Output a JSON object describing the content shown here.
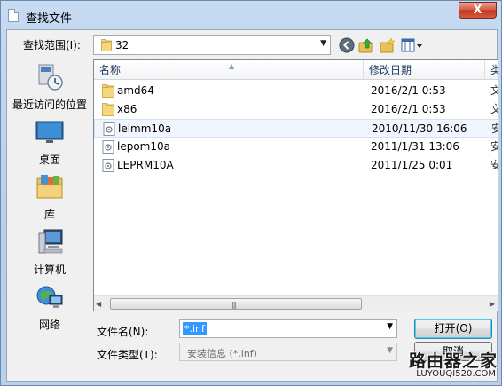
{
  "window": {
    "title": "查找文件",
    "close_glyph": "X"
  },
  "lookin": {
    "label": "查找范围(I):",
    "value": "32"
  },
  "toolbar": {
    "icons": [
      "back-icon",
      "up-folder-icon",
      "new-folder-icon",
      "views-menu-icon"
    ]
  },
  "places": [
    {
      "label": "最近访问的位置",
      "icon": "recent-places-icon"
    },
    {
      "label": "桌面",
      "icon": "desktop-icon"
    },
    {
      "label": "库",
      "icon": "libraries-icon"
    },
    {
      "label": "计算机",
      "icon": "computer-icon"
    },
    {
      "label": "网络",
      "icon": "network-icon"
    }
  ],
  "filelist": {
    "columns": {
      "name": "名称",
      "date": "修改日期",
      "more": "类"
    },
    "rows": [
      {
        "name": "amd64",
        "date": "2016/2/1 0:53",
        "more": "文",
        "type": "folder"
      },
      {
        "name": "x86",
        "date": "2016/2/1 0:53",
        "more": "文",
        "type": "folder"
      },
      {
        "name": "leimm10a",
        "date": "2010/11/30 16:06",
        "more": "安",
        "type": "inf",
        "selected": true
      },
      {
        "name": "lepom10a",
        "date": "2011/1/31 13:06",
        "more": "安",
        "type": "inf"
      },
      {
        "name": "LEPRM10A",
        "date": "2011/1/25 0:01",
        "more": "安",
        "type": "inf"
      }
    ],
    "scroll_grip": "|||"
  },
  "fields": {
    "filename_label": "文件名(N):",
    "filename_value": "*.inf",
    "filetype_label": "文件类型(T):",
    "filetype_value": "安装信息 (*.inf)"
  },
  "buttons": {
    "open": "打开(O)",
    "cancel": "取消"
  },
  "watermark": {
    "title": "路由器之家",
    "url": "LUYOUQI520.COM"
  },
  "colors": {
    "title_gradient": "#c6dbf2",
    "folder": "#e8c15b",
    "selection": "#3399ff",
    "close_button": "#c4381f"
  }
}
